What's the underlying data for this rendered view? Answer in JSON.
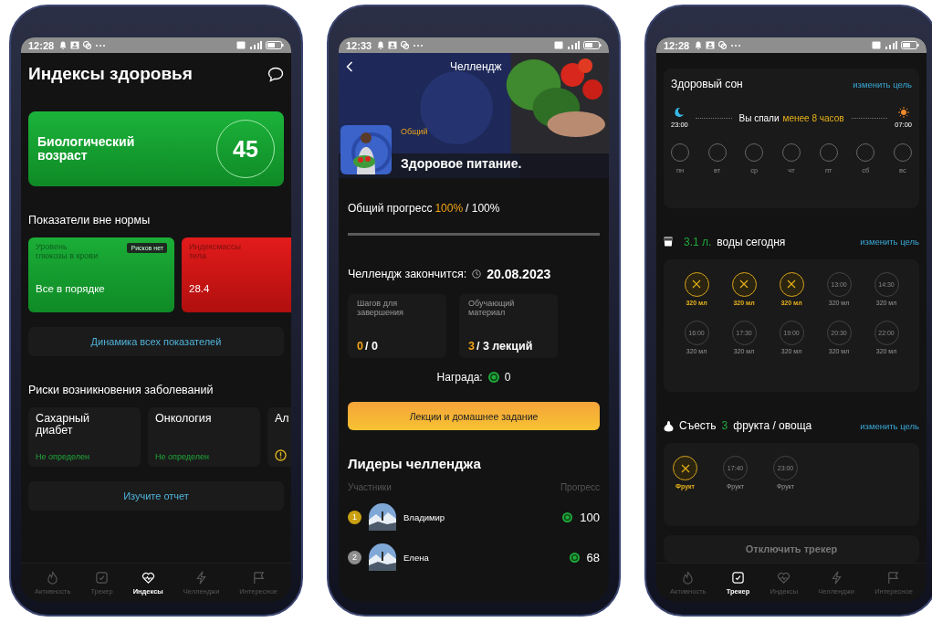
{
  "indices_screen": {
    "status_time": "12:28",
    "title": "Индексы здоровья",
    "bio_age": {
      "label": "Биологический возраст",
      "value": "45"
    },
    "abnormal_title": "Показатели вне нормы",
    "indicators": [
      {
        "kind": "normal",
        "label": "Уровень глюкозы в крови",
        "badge": "Рисков нет",
        "value": "Все в порядке"
      },
      {
        "kind": "alert",
        "label": "Индексмассы тела",
        "value": "28.4"
      }
    ],
    "dynamics_button": "Динамика всех показателей",
    "risks_title": "Риски возникновения заболеваний",
    "risks": [
      {
        "kind": "undetermined",
        "name": "Сахарный диабет",
        "status": "Не определен"
      },
      {
        "kind": "undetermined",
        "name": "Онкология",
        "status": "Не определен"
      },
      {
        "kind": "warning",
        "name": "Ал"
      }
    ],
    "report_button": "Изучите отчет",
    "tabs": [
      {
        "label": "Активность",
        "selected": false
      },
      {
        "label": "Трекер",
        "selected": false
      },
      {
        "label": "Индексы",
        "selected": true
      },
      {
        "label": "Челленджи",
        "selected": false
      },
      {
        "label": "Интересное",
        "selected": false
      }
    ]
  },
  "challenge_screen": {
    "status_time": "12:33",
    "title": "Челлендж",
    "category": "Общий",
    "name": "Здоровое питание.",
    "progress": {
      "label": "Общий прогресс",
      "value": "100%",
      "total": "/ 100%",
      "level": 1
    },
    "end": {
      "label": "Челлендж закончится:",
      "date": "20.08.2023"
    },
    "stats": [
      {
        "label": "Шагов для завершения",
        "done": "0",
        "total": "/ 0"
      },
      {
        "label": "Обучающий материал",
        "done": "3",
        "total": "/ 3 лекций"
      }
    ],
    "reward": {
      "label": "Награда:",
      "value": "0"
    },
    "lectures_button": "Лекции и домашнее задание",
    "leaders_title": "Лидеры челленджа",
    "columns": [
      "Участники",
      "Прогресс"
    ],
    "leaders": [
      {
        "rank": "1",
        "color": "#c9a012",
        "name": "Владимир",
        "score": "100"
      },
      {
        "rank": "2",
        "color": "#8e8e8e",
        "name": "Елена",
        "score": "68"
      }
    ]
  },
  "tracker_screen": {
    "status_time": "12:28",
    "sleep": {
      "title": "Здоровый сон",
      "link": "изменить цель",
      "start": "23:00",
      "text": "Вы спали",
      "highlight": "менее 8 часов",
      "end": "07:00",
      "days": [
        {
          "label": "пн",
          "done": false
        },
        {
          "label": "вт",
          "done": false
        },
        {
          "label": "ср",
          "done": false
        },
        {
          "label": "чт",
          "done": false
        },
        {
          "label": "пт",
          "done": false
        },
        {
          "label": "сб",
          "done": false
        },
        {
          "label": "вс",
          "done": false
        }
      ]
    },
    "water": {
      "amount": "3.1 л.",
      "text": "воды сегодня",
      "link": "изменить цель",
      "items": [
        {
          "done": true,
          "volume": "320 мл"
        },
        {
          "done": true,
          "volume": "320 мл"
        },
        {
          "done": true,
          "volume": "320 мл"
        },
        {
          "done": false,
          "time": "13:00",
          "volume": "320 мл"
        },
        {
          "done": false,
          "time": "14:30",
          "volume": "320 мл"
        },
        {
          "done": false,
          "time": "16:00",
          "volume": "320 мл"
        },
        {
          "done": false,
          "time": "17:30",
          "volume": "320 мл"
        },
        {
          "done": false,
          "time": "19:00",
          "volume": "320 мл"
        },
        {
          "done": false,
          "time": "20:30",
          "volume": "320 мл"
        },
        {
          "done": false,
          "time": "22:00",
          "volume": "320 мл"
        }
      ]
    },
    "fruit": {
      "prefix": "Съесть",
      "count": "3",
      "suffix": "фрукта / овоща",
      "link": "изменить цель",
      "items": [
        {
          "done": true,
          "label": "Фрукт"
        },
        {
          "done": false,
          "time": "17:40",
          "label": "Фрукт"
        },
        {
          "done": false,
          "time": "23:00",
          "label": "Фрукт"
        }
      ]
    },
    "disable_button": "Отключить трекер",
    "tabs": [
      {
        "label": "Активность",
        "selected": false
      },
      {
        "label": "Трекер",
        "selected": true
      },
      {
        "label": "Индексы",
        "selected": false
      },
      {
        "label": "Челленджи",
        "selected": false
      },
      {
        "label": "Интересное",
        "selected": false
      }
    ]
  }
}
